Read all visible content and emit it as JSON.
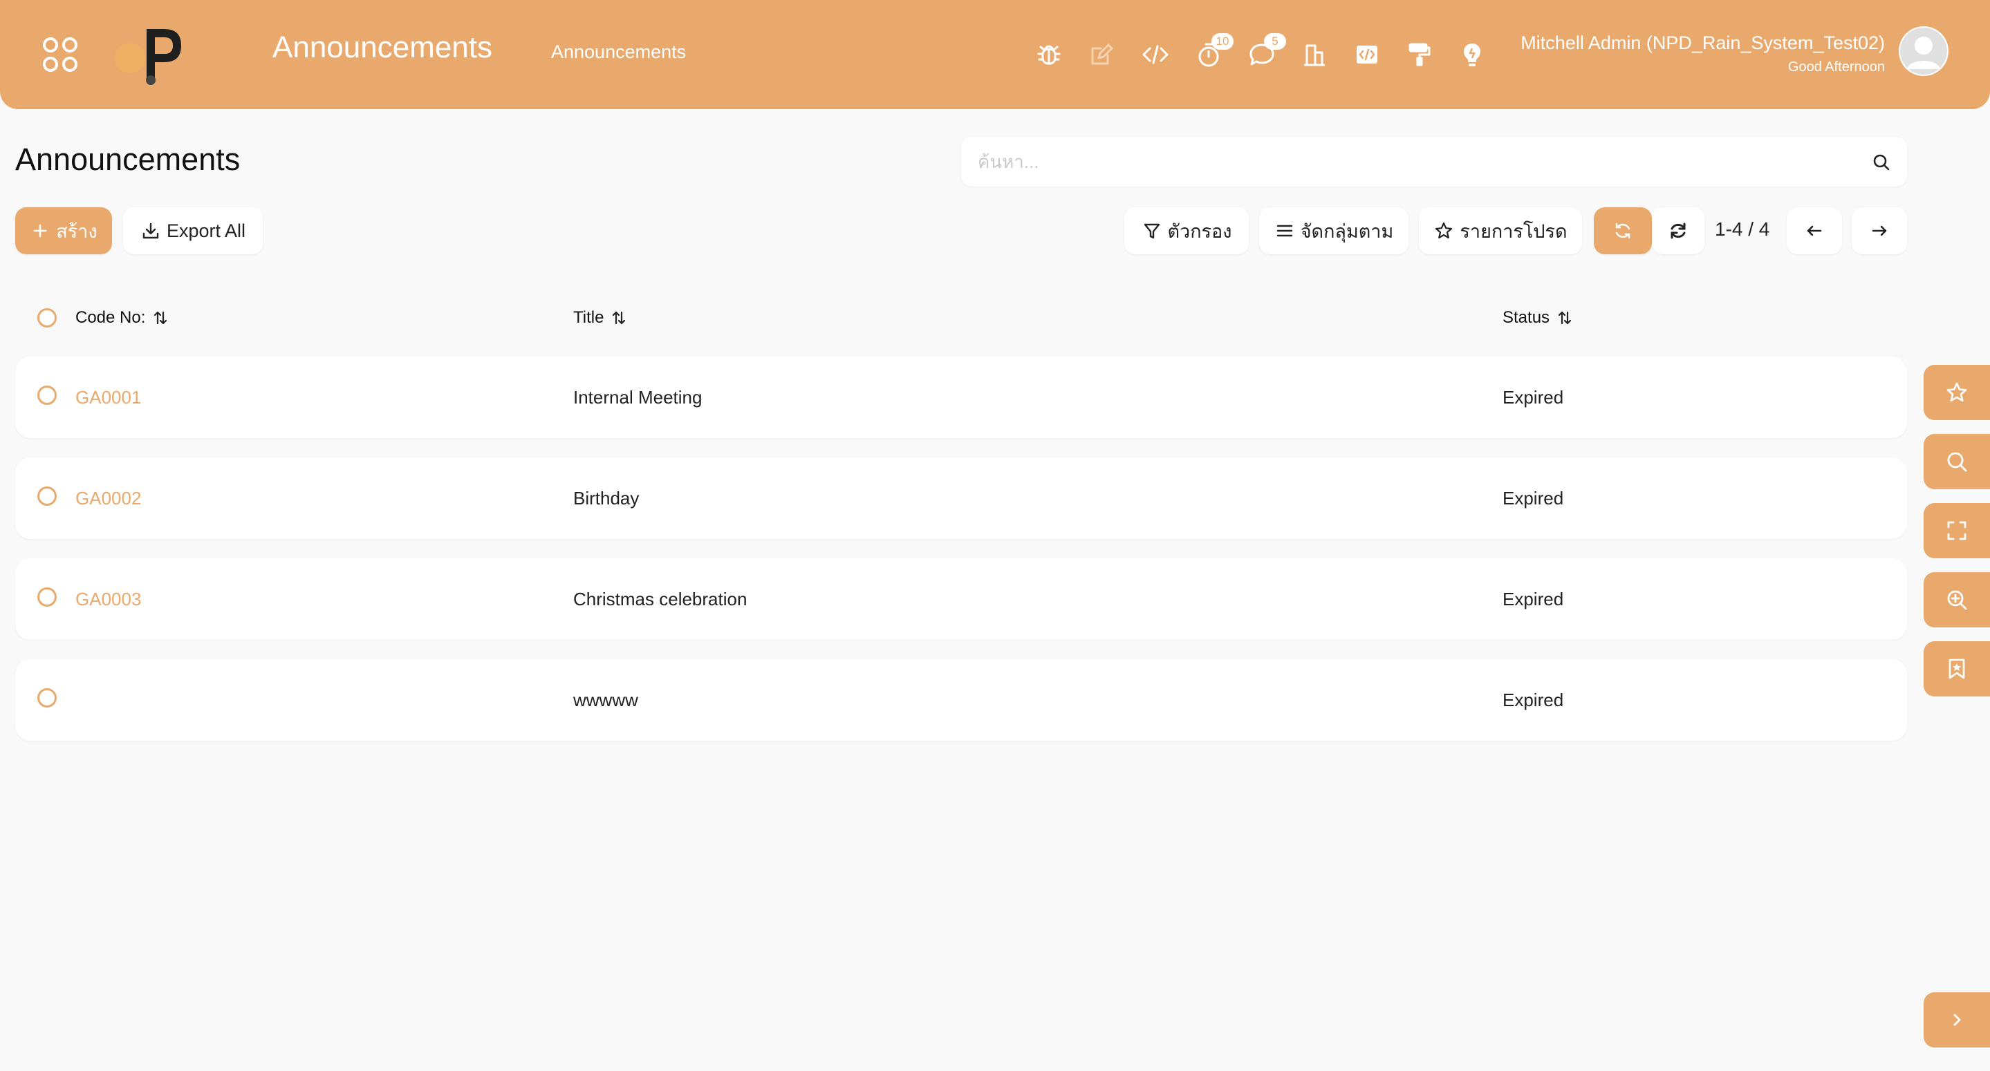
{
  "header": {
    "app_title": "Announcements",
    "menu_link": "Announcements",
    "badges": {
      "timer": "10",
      "chat": "5"
    },
    "user_name": "Mitchell Admin (NPD_Rain_System_Test02)",
    "greeting": "Good Afternoon"
  },
  "control_panel": {
    "page_title": "Announcements",
    "search_placeholder": "ค้นหา...",
    "create_label": "สร้าง",
    "export_label": "Export All",
    "filter_label": "ตัวกรอง",
    "groupby_label": "จัดกลุ่มตาม",
    "favorites_label": "รายการโปรด",
    "pager": "1-4 / 4"
  },
  "list": {
    "columns": [
      "Code No:",
      "Title",
      "Status"
    ],
    "rows": [
      {
        "code": "GA0001",
        "title": "Internal Meeting",
        "status": "Expired"
      },
      {
        "code": "GA0002",
        "title": "Birthday",
        "status": "Expired"
      },
      {
        "code": "GA0003",
        "title": "Christmas celebration",
        "status": "Expired"
      },
      {
        "code": "",
        "title": "wwwww",
        "status": "Expired"
      }
    ]
  },
  "colors": {
    "accent": "#e9a96c",
    "background": "#f9f9f9",
    "card": "#ffffff"
  },
  "icons": {
    "header": [
      "apps-icon",
      "bug-icon",
      "edit-icon",
      "code-icon",
      "timer-icon",
      "chat-icon",
      "building-icon",
      "code-box-icon",
      "paint-roller-icon",
      "lightbulb-icon"
    ],
    "side": [
      "star-icon",
      "search-icon",
      "fullscreen-icon",
      "zoom-in-icon",
      "bookmark-star-icon",
      "chevron-right-icon"
    ]
  }
}
